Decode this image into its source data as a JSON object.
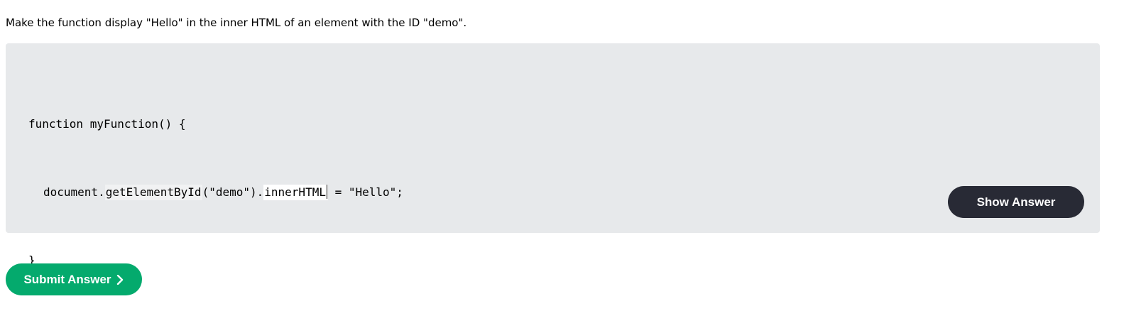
{
  "instruction": "Make the function display \"Hello\" in the inner HTML of an element with the ID \"demo\".",
  "code": {
    "line1": "function myFunction() {",
    "line2_prefix": "document.",
    "blank1_value": "getElementById",
    "line2_middle": "(\"demo\").",
    "blank2_value": "innerHTML",
    "line2_suffix": " = \"Hello\";",
    "line3": "}"
  },
  "buttons": {
    "show_answer": "Show Answer",
    "submit_answer": "Submit Answer"
  },
  "icons": {
    "submit_chevron": "chevron-right-icon"
  },
  "colors": {
    "code_panel_bg": "#e7e9eb",
    "show_answer_bg": "#282a35",
    "submit_bg": "#04aa6d"
  }
}
